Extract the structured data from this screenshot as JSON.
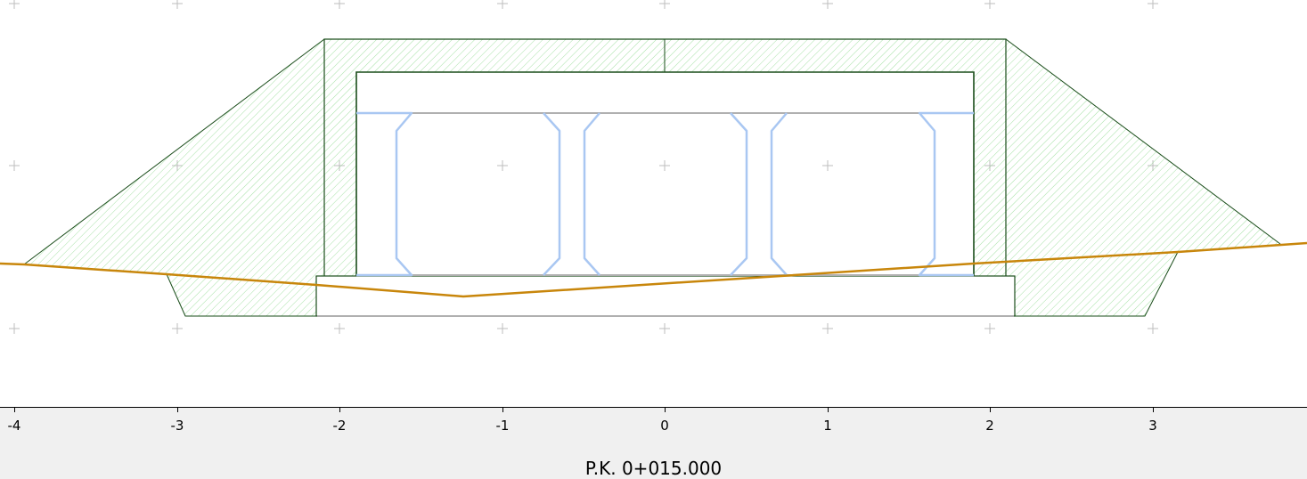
{
  "axis": {
    "ticks": [
      {
        "value": -4,
        "label": "-4"
      },
      {
        "value": -3,
        "label": "-3"
      },
      {
        "value": -2,
        "label": "-2"
      },
      {
        "value": -1,
        "label": "-1"
      },
      {
        "value": 0,
        "label": "0"
      },
      {
        "value": 1,
        "label": "1"
      },
      {
        "value": 2,
        "label": "2"
      },
      {
        "value": 3,
        "label": "3"
      }
    ]
  },
  "station_label": "P.K. 0+015.000",
  "colors": {
    "hatch": "#8fd98f",
    "outline": "#1a4d1a",
    "terrain": "#c8860b",
    "beam": "#a9c7f2",
    "slab_line": "#b0b0b0",
    "grid_mark": "#bdbdbd"
  }
}
